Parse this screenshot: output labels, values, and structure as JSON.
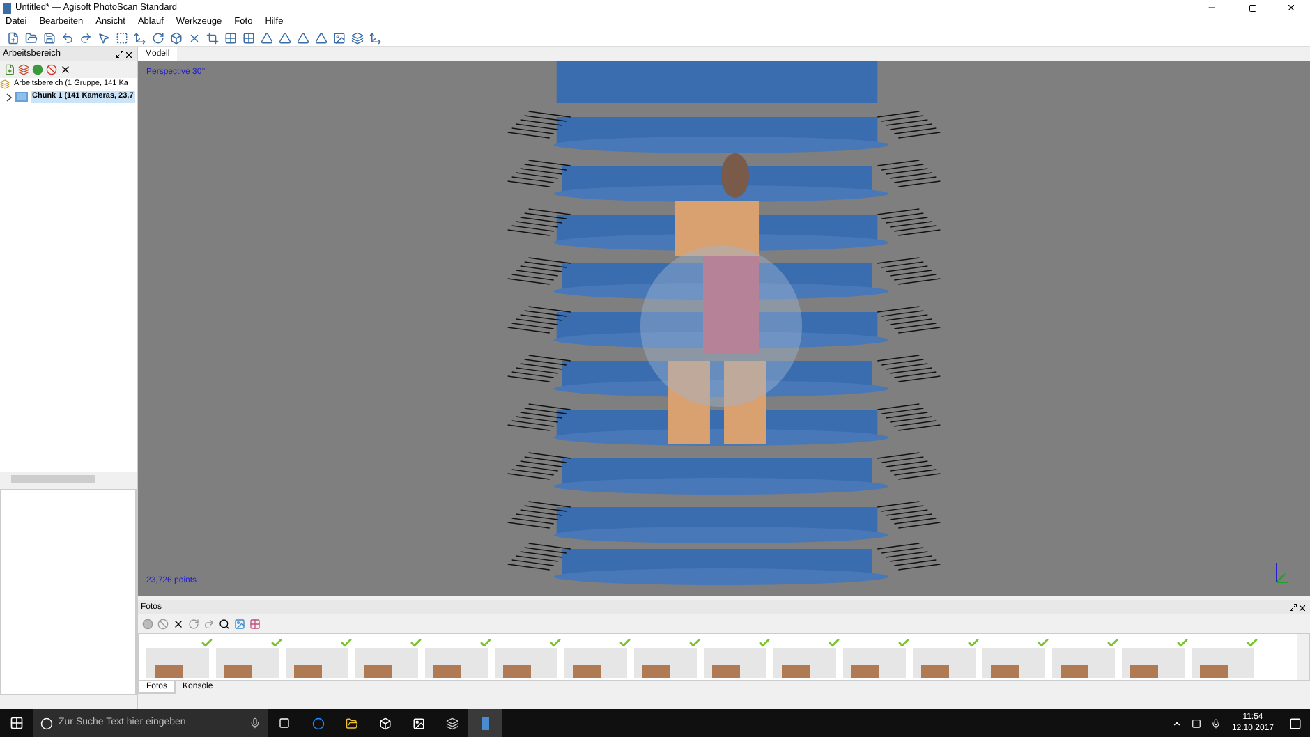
{
  "window": {
    "title": "Untitled* — Agisoft PhotoScan Standard"
  },
  "menu": [
    "Datei",
    "Bearbeiten",
    "Ansicht",
    "Ablauf",
    "Werkzeuge",
    "Foto",
    "Hilfe"
  ],
  "workspace_panel": {
    "title": "Arbeitsbereich",
    "tree": [
      {
        "label": "Arbeitsbereich (1 Gruppe, 141 Ka",
        "children": [
          {
            "label": "Chunk 1 (141 Kameras, 23,7",
            "expanded": false,
            "selected": true
          }
        ]
      }
    ]
  },
  "view_tabs": [
    {
      "label": "Modell",
      "selected": true
    }
  ],
  "viewport": {
    "projection": "Perspective 30°",
    "point_count": "23,726 points"
  },
  "photos_panel": {
    "title": "Fotos",
    "photos": [
      {
        "checked": true
      },
      {
        "checked": true
      },
      {
        "checked": true
      },
      {
        "checked": true
      },
      {
        "checked": true
      },
      {
        "checked": true
      },
      {
        "checked": true
      },
      {
        "checked": true
      },
      {
        "checked": true
      },
      {
        "checked": true
      },
      {
        "checked": true
      },
      {
        "checked": true
      },
      {
        "checked": true
      },
      {
        "checked": true
      },
      {
        "checked": true
      },
      {
        "checked": true
      }
    ],
    "tabs": [
      {
        "label": "Fotos",
        "selected": true
      },
      {
        "label": "Konsole",
        "selected": false
      }
    ]
  },
  "taskbar": {
    "search_placeholder": "Zur Suche Text hier eingeben",
    "time": "11:54",
    "date": "12.10.2017"
  }
}
